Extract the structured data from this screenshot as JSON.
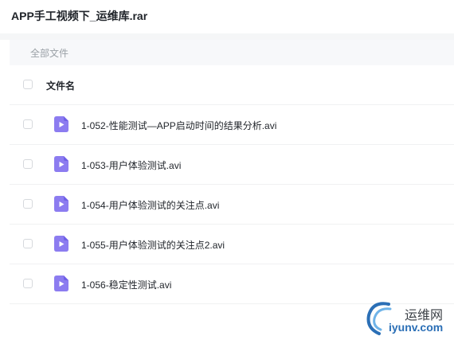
{
  "window": {
    "title": "APP手工视频下_运维库.rar"
  },
  "breadcrumb": {
    "label": "全部文件"
  },
  "file_list": {
    "header": {
      "name_label": "文件名"
    },
    "items": [
      {
        "name": "1-052-性能测试—APP启动时间的结果分析.avi",
        "icon": "video-file-icon"
      },
      {
        "name": "1-053-用户体验测试.avi",
        "icon": "video-file-icon"
      },
      {
        "name": "1-054-用户体验测试的关注点.avi",
        "icon": "video-file-icon"
      },
      {
        "name": "1-055-用户体验测试的关注点2.avi",
        "icon": "video-file-icon"
      },
      {
        "name": "1-056-稳定性测试.avi",
        "icon": "video-file-icon"
      }
    ]
  },
  "watermark": {
    "name_cn": "运维网",
    "domain": "iyunv.com"
  },
  "colors": {
    "icon_purple": "#8c7cf0",
    "icon_purple_dark": "#6f5fe6",
    "watermark_blue": "#2b6fb6"
  }
}
